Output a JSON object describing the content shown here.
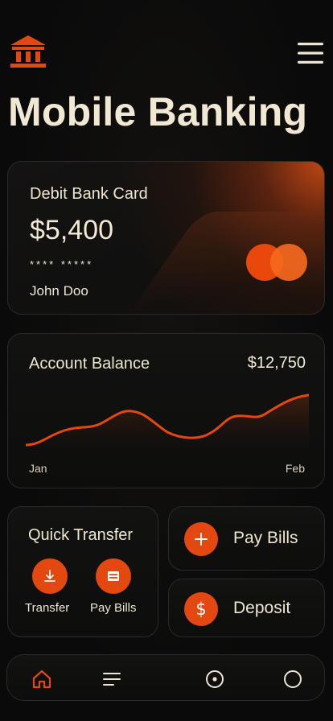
{
  "app": {
    "title": "Mobile Banking"
  },
  "header": {
    "logo_icon": "bank-icon",
    "menu_icon": "hamburger-menu-icon"
  },
  "debit_card": {
    "title": "Debit Bank Card",
    "amount": "$5,400",
    "masked_number": "**** *****",
    "holder": "John Doo",
    "brand_icon": "card-network-logo"
  },
  "balance": {
    "title": "Account Balance",
    "amount": "$12,750",
    "x_start_label": "Jan",
    "x_end_label": "Feb"
  },
  "quick_transfer": {
    "title": "Quick Transfer",
    "actions": [
      {
        "label": "Transfer",
        "icon": "download-icon"
      },
      {
        "label": "Pay Bills",
        "icon": "bill-icon"
      }
    ]
  },
  "actions": {
    "pay_bills": {
      "label": "Pay Bills",
      "icon": "plus-icon"
    },
    "deposit": {
      "label": "Deposit",
      "icon": "dollar-icon"
    }
  },
  "bottom_nav": {
    "items": [
      {
        "icon": "home-icon",
        "active": true
      },
      {
        "icon": "list-icon",
        "active": false
      },
      {
        "icon": "target-icon",
        "active": false
      },
      {
        "icon": "circle-icon",
        "active": false
      }
    ]
  },
  "colors": {
    "accent": "#e2480f",
    "background": "#0b0b0b",
    "text": "#efe6d2"
  }
}
